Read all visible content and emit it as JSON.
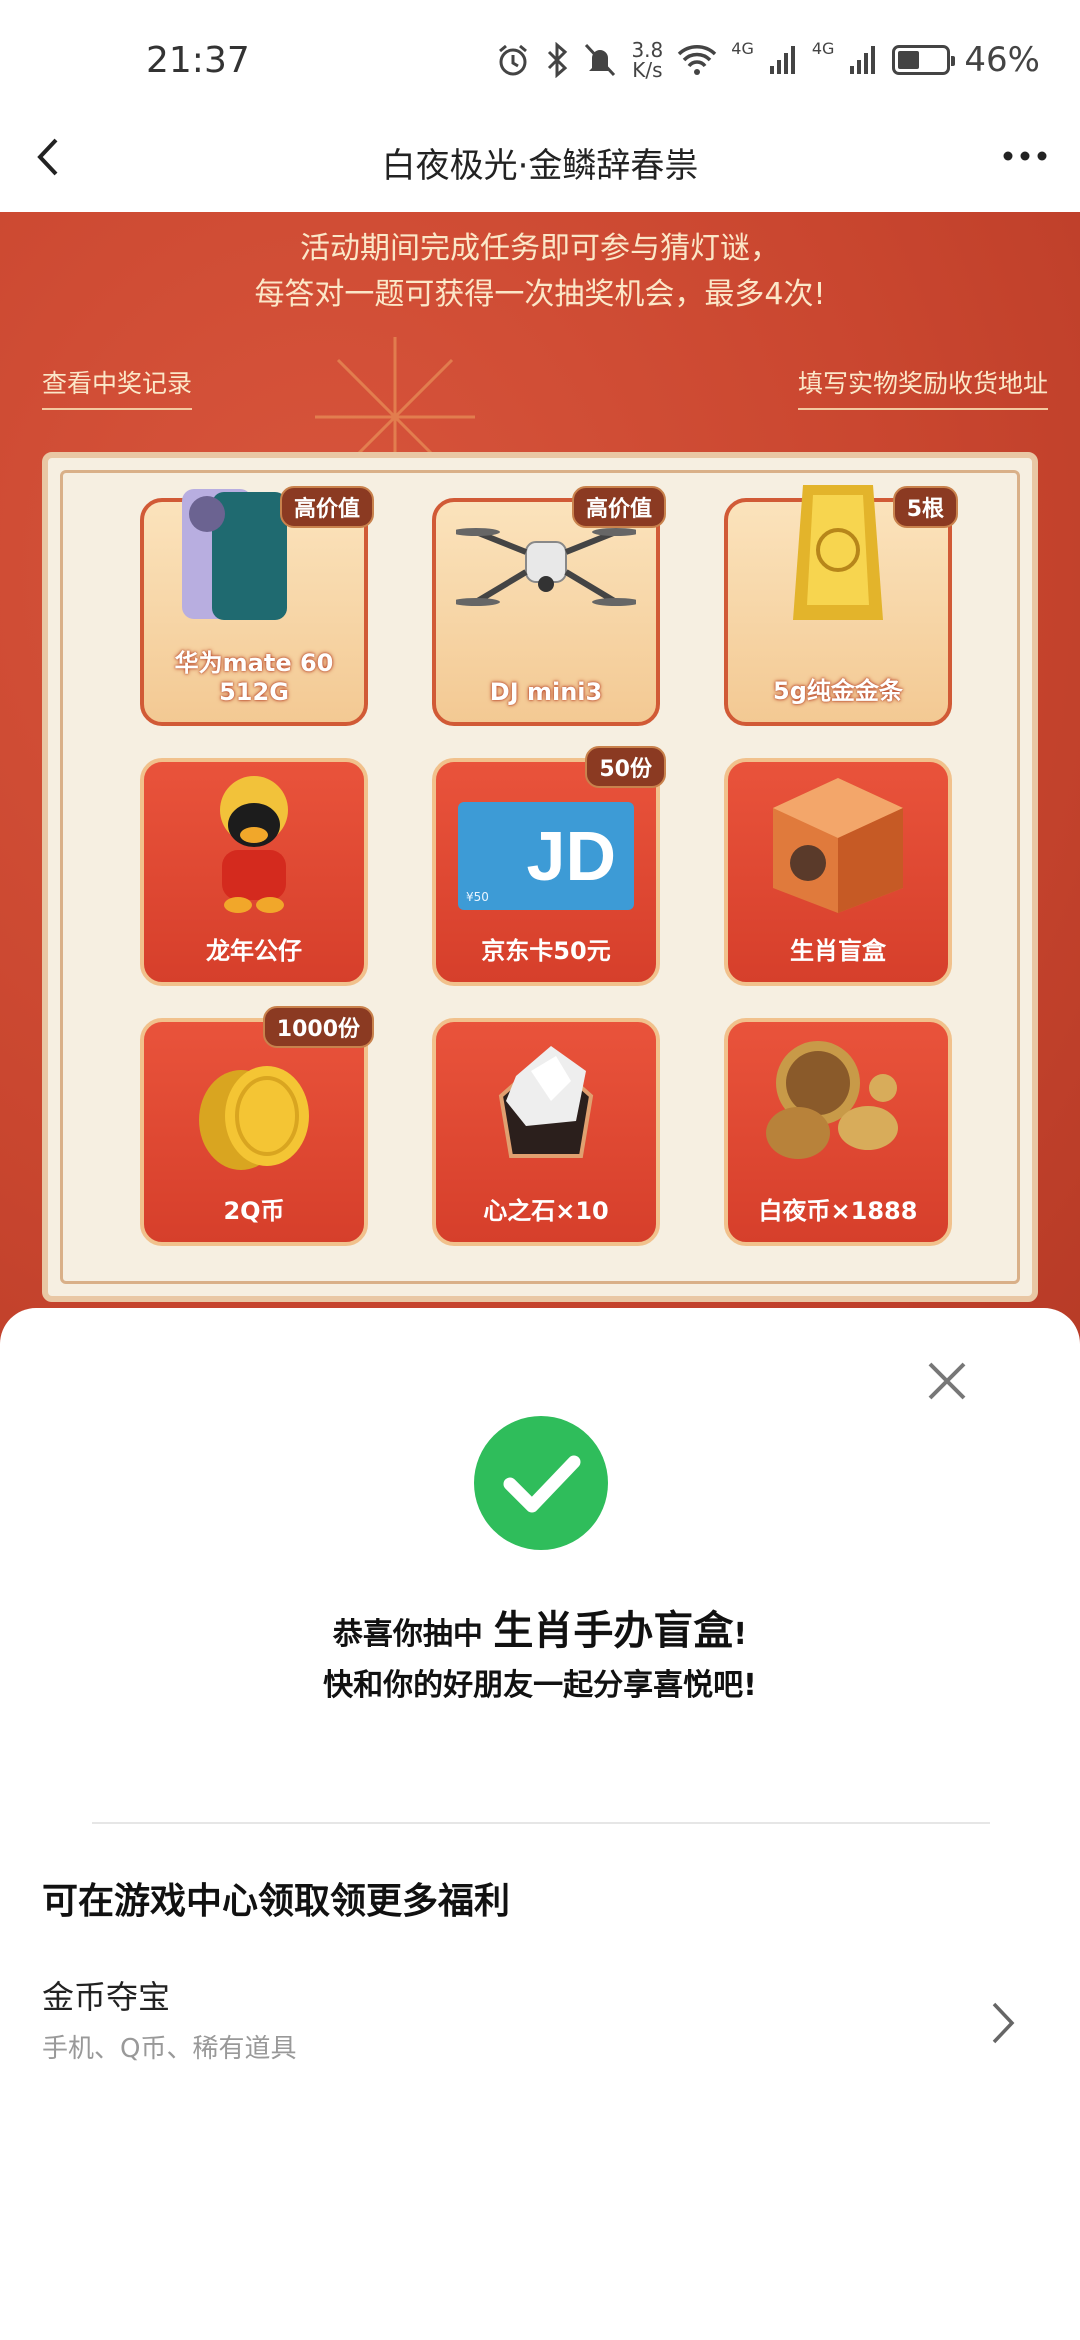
{
  "status_bar": {
    "time": "21:37",
    "net_speed_value": "3.8",
    "net_speed_unit": "K/s",
    "network_1": "4G",
    "network_2": "4G",
    "battery_percent": "46%",
    "battery_level": 0.46
  },
  "nav": {
    "title": "白夜极光·金鳞辞春祟"
  },
  "banner": {
    "line1": "活动期间完成任务即可参与猜灯谜，",
    "line2": "每答对一题可获得一次抽奖机会，最多4次!",
    "record_link": "查看中奖记录",
    "address_link": "填写实物奖励收货地址"
  },
  "prizes": [
    {
      "label": "华为mate 60 512G",
      "badge": "高价值",
      "icon": "phone-icon"
    },
    {
      "label": "DJ mini3",
      "badge": "高价值",
      "icon": "drone-icon"
    },
    {
      "label": "5g纯金金条",
      "badge": "5根",
      "icon": "gold-bar-icon"
    },
    {
      "label": "龙年公仔",
      "badge": "",
      "icon": "plush-doll-icon"
    },
    {
      "label": "京东卡50元",
      "badge": "50份",
      "icon": "jd-card-icon",
      "card_text": "JD",
      "card_value": "¥50"
    },
    {
      "label": "生肖盲盒",
      "badge": "",
      "icon": "blind-box-icon"
    },
    {
      "label": "2Q币",
      "badge": "1000份",
      "icon": "q-coin-icon"
    },
    {
      "label": "心之石×10",
      "badge": "",
      "icon": "crystal-stone-icon"
    },
    {
      "label": "白夜币×1888",
      "badge": "",
      "icon": "game-coin-icon"
    }
  ],
  "dialog": {
    "congrats_prefix": "恭喜你抽中",
    "prize_name": "生肖手办盲盒",
    "exclaim": "!",
    "share_text": "快和你的好朋友一起分享喜悦吧!",
    "section_title": "可在游戏中心领取领更多福利",
    "entry_title": "金币夺宝",
    "entry_subtitle": "手机、Q币、稀有道具"
  },
  "colors": {
    "banner_red": "#c9462f",
    "success_green": "#2fbd5b",
    "cream": "#f6efe1"
  }
}
